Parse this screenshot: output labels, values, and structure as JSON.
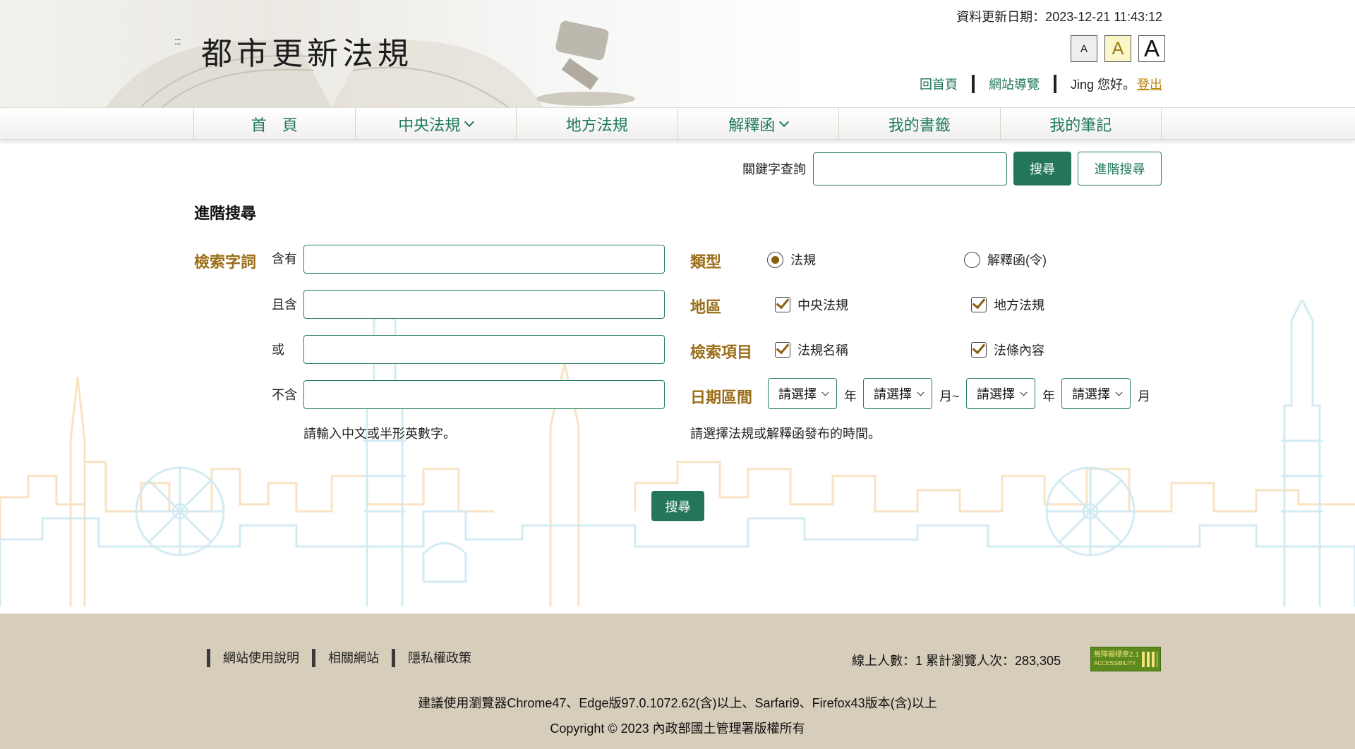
{
  "header": {
    "accessibility_key": ":::",
    "site_title": "都市更新法規",
    "update_date": "資料更新日期：2023-12-21 11:43:12",
    "font_sizes": [
      "A",
      "A",
      "A"
    ],
    "links": {
      "home": "回首頁",
      "sitemap": "網站導覽",
      "greeting": "Jing 您好。",
      "logout": "登出"
    }
  },
  "nav": {
    "items": [
      {
        "label": "首　頁",
        "has_dropdown": false
      },
      {
        "label": "中央法規",
        "has_dropdown": true
      },
      {
        "label": "地方法規",
        "has_dropdown": false
      },
      {
        "label": "解釋函",
        "has_dropdown": true
      },
      {
        "label": "我的書籤",
        "has_dropdown": false
      },
      {
        "label": "我的筆記",
        "has_dropdown": false
      }
    ]
  },
  "quick_search": {
    "label": "關鍵字查詢",
    "input_value": "",
    "search_button": "搜尋",
    "advanced_button": "進階搜尋"
  },
  "advanced": {
    "title": "進階搜尋",
    "terms_label": "檢索字詞",
    "include": "含有",
    "and_include": "且含",
    "or": "或",
    "exclude": "不含",
    "include_value": "",
    "and_include_value": "",
    "or_value": "",
    "exclude_value": "",
    "terms_hint": "請輸入中文或半形英數字。",
    "type_label": "類型",
    "type_options": [
      "法規",
      "解釋函(令)"
    ],
    "type_selected": "法規",
    "region_label": "地區",
    "region_options": [
      "中央法規",
      "地方法規"
    ],
    "region_checked": [
      true,
      true
    ],
    "scope_label": "檢索項目",
    "scope_options": [
      "法規名稱",
      "法條內容"
    ],
    "scope_checked": [
      true,
      true
    ],
    "date_label": "日期區間",
    "select_placeholder": "請選擇",
    "unit_year": "年",
    "unit_month_to": "月~",
    "unit_month": "月",
    "date_hint": "請選擇法規或解釋函發布的時間。",
    "search_button": "搜尋"
  },
  "footer": {
    "links": [
      "網站使用說明",
      "相關網站",
      "隱私權政策"
    ],
    "visitors": "線上人數：1  累計瀏覽人次：283,305",
    "badge_line1": "無障礙標章2.1",
    "badge_line2": "ACCESSIBILITY",
    "browser_note": "建議使用瀏覽器Chrome47、Edge版97.0.1072.62(含)以上、Sarfari9、Firefox43版本(含)以上",
    "copyright": "Copyright © 2023 內政部國土管理署版權所有"
  },
  "colors": {
    "accent_green": "#23765b",
    "label_gold": "#9b6e18",
    "footer_bg": "#d6cdbb"
  }
}
